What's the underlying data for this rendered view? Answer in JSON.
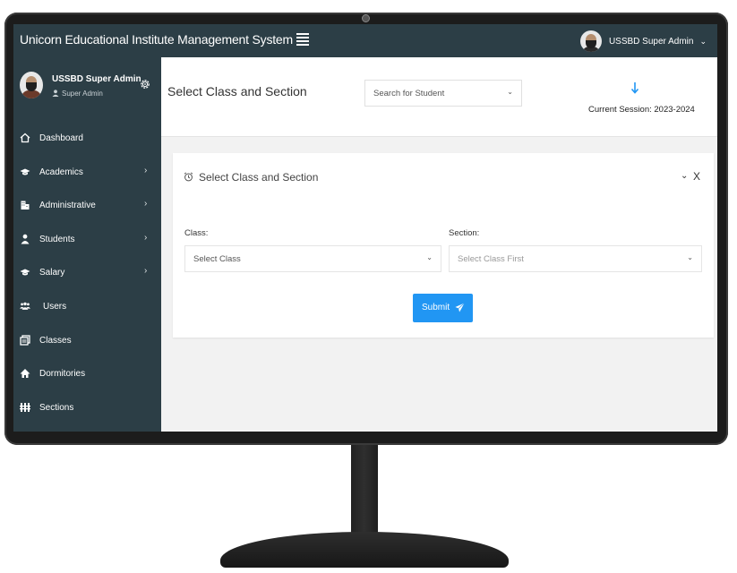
{
  "app": {
    "title": "Unicorn Educational Institute Management System"
  },
  "topbar": {
    "user_name": "USSBD Super Admin",
    "user_chevron": "⌄"
  },
  "sidebar": {
    "profile": {
      "name": "USSBD Super Admin",
      "role": "Super Admin"
    },
    "items": [
      {
        "label": "Dashboard",
        "icon": "home-icon",
        "has_submenu": false
      },
      {
        "label": "Academics",
        "icon": "graduation-cap-icon",
        "has_submenu": true
      },
      {
        "label": "Administrative",
        "icon": "building-icon",
        "has_submenu": true
      },
      {
        "label": "Students",
        "icon": "student-icon",
        "has_submenu": true
      },
      {
        "label": "Salary",
        "icon": "graduation-cap-icon",
        "has_submenu": true
      },
      {
        "label": "Users",
        "icon": "users-icon",
        "has_submenu": false
      },
      {
        "label": "Classes",
        "icon": "classes-icon",
        "has_submenu": false
      },
      {
        "label": "Dormitories",
        "icon": "dormitory-icon",
        "has_submenu": false
      },
      {
        "label": "Sections",
        "icon": "sections-icon",
        "has_submenu": false
      }
    ],
    "caret": "›"
  },
  "header": {
    "page_title": "Select Class and Section",
    "student_search_placeholder": "Search for Student",
    "session_text": "Current Session: 2023-2024"
  },
  "card": {
    "title": "Select Class and Section",
    "collapse": "⌄",
    "close": "X",
    "class_label": "Class:",
    "class_placeholder": "Select Class",
    "section_label": "Section:",
    "section_placeholder": "Select Class First",
    "submit_label": "Submit"
  },
  "colors": {
    "sidebar_bg": "#2c3e46",
    "accent": "#2196f3",
    "content_bg": "#f2f2f2"
  }
}
